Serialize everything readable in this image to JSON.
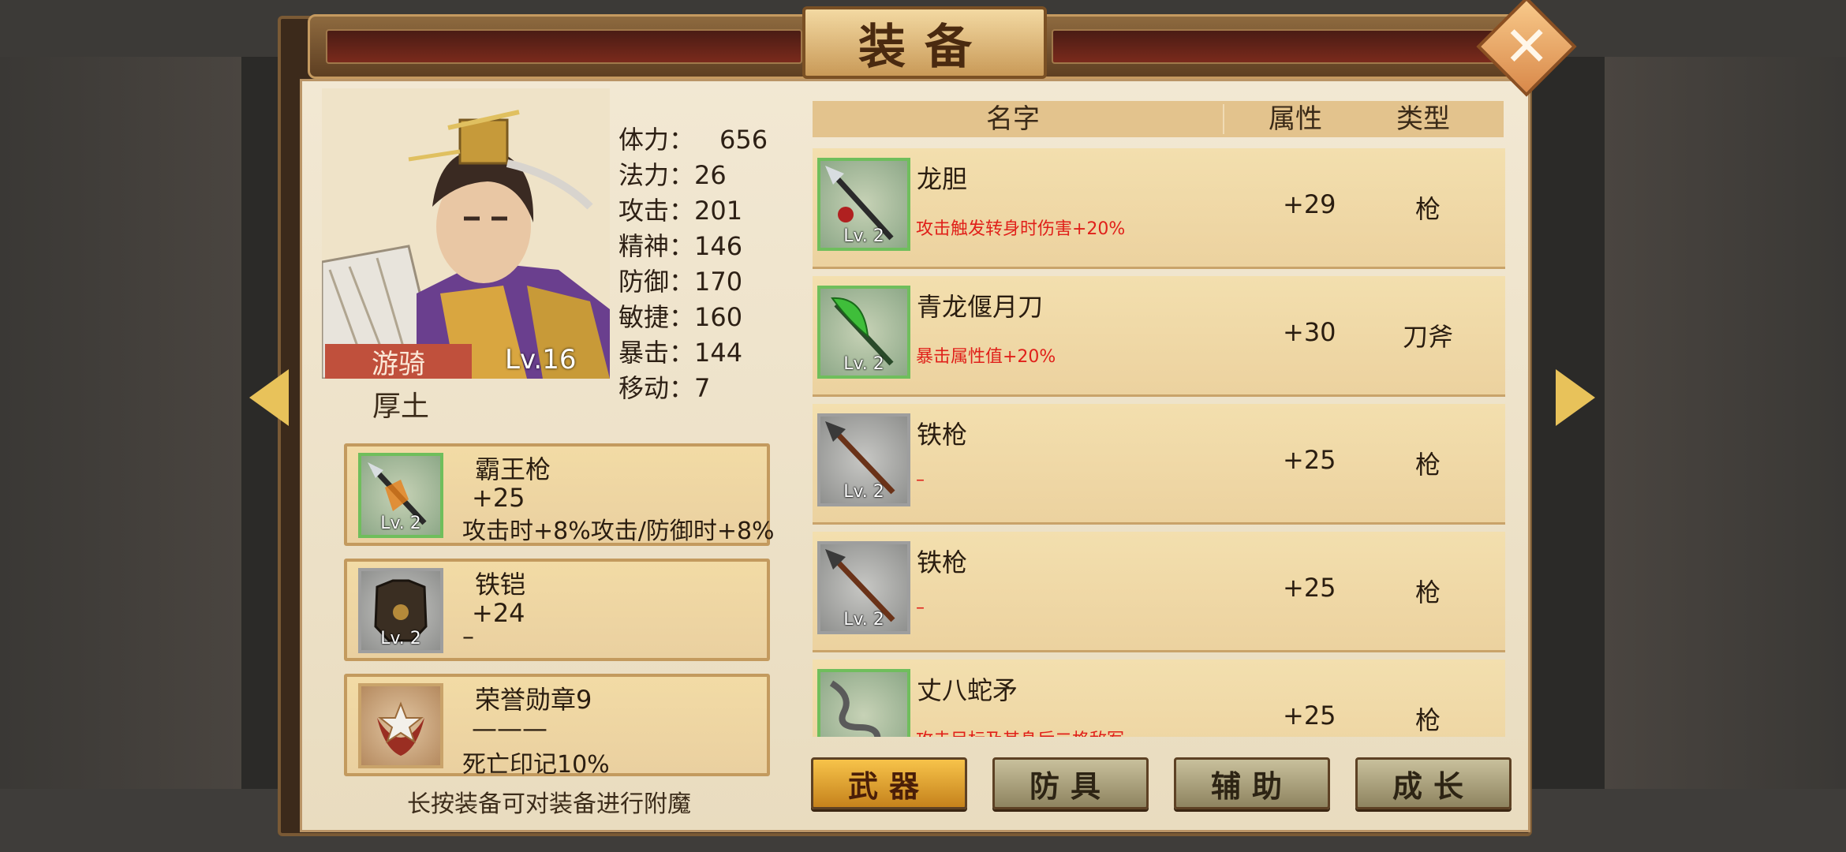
{
  "title": "装备",
  "close_label": "✕",
  "hero": {
    "class": "游骑",
    "level": "Lv.16",
    "element": "厚土",
    "stats": [
      {
        "label": "体力：",
        "value": "656"
      },
      {
        "label": "法力：",
        "value": "26"
      },
      {
        "label": "攻击：",
        "value": "201"
      },
      {
        "label": "精神：",
        "value": "146"
      },
      {
        "label": "防御：",
        "value": "170"
      },
      {
        "label": "敏捷：",
        "value": "160"
      },
      {
        "label": "暴击：",
        "value": "144"
      },
      {
        "label": "移动：",
        "value": "7"
      }
    ]
  },
  "equipped": [
    {
      "name": "霸王枪",
      "bonus": "+25",
      "effect": "攻击时+8%攻击/防御时+8%",
      "level": "Lv. 2",
      "icon": "spear-icon"
    },
    {
      "name": "铁铠",
      "bonus": "+24",
      "effect": "–",
      "level": "Lv. 2",
      "icon": "armor-icon"
    },
    {
      "name": "荣誉勋章9",
      "bonus": "———",
      "effect": "死亡印记10%",
      "level": "",
      "icon": "medal-icon"
    }
  ],
  "hint": "长按装备可对装备进行附魔",
  "list_header": {
    "name": "名字",
    "attr": "属性",
    "type": "类型"
  },
  "items": [
    {
      "name": "龙胆",
      "effect": "攻击触发转身时伤害+20%",
      "attr": "+29",
      "type": "枪",
      "level": "Lv. 2",
      "icon": "spear-icon"
    },
    {
      "name": "青龙偃月刀",
      "effect": "暴击属性值+20%",
      "attr": "+30",
      "type": "刀斧",
      "level": "Lv. 2",
      "icon": "glaive-icon"
    },
    {
      "name": "铁枪",
      "effect": "–",
      "attr": "+25",
      "type": "枪",
      "level": "Lv. 2",
      "icon": "spear-icon"
    },
    {
      "name": "铁枪",
      "effect": "–",
      "attr": "+25",
      "type": "枪",
      "level": "Lv. 2",
      "icon": "spear-icon"
    },
    {
      "name": "丈八蛇矛",
      "effect": "攻击目标及其身后二格敌军",
      "attr": "+25",
      "type": "枪",
      "level": "",
      "icon": "serpent-spear-icon"
    }
  ],
  "tabs": [
    {
      "label": "武器",
      "active": true
    },
    {
      "label": "防具",
      "active": false
    },
    {
      "label": "辅助",
      "active": false
    },
    {
      "label": "成长",
      "active": false
    }
  ]
}
